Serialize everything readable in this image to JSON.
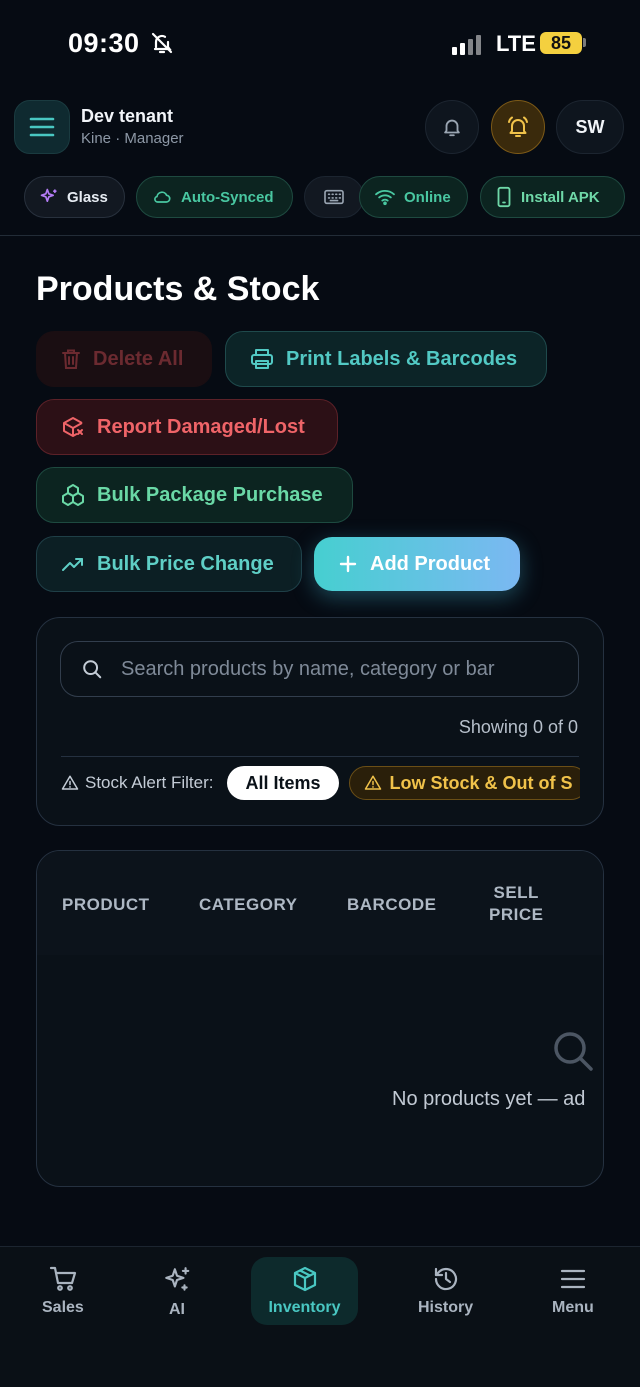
{
  "status_bar": {
    "time": "09:30",
    "network": "LTE",
    "battery": "85"
  },
  "header": {
    "tenant_name": "Dev tenant",
    "tenant_subtitle": "Kine · Manager",
    "avatar_initials": "SW"
  },
  "chips": {
    "glass": "Glass",
    "sync": "Auto-Synced",
    "online": "Online",
    "install": "Install APK"
  },
  "page": {
    "title": "Products & Stock"
  },
  "actions": {
    "delete_all": "Delete All",
    "print_labels": "Print Labels & Barcodes",
    "report_damaged": "Report Damaged/Lost",
    "bulk_package": "Bulk Package Purchase",
    "bulk_price": "Bulk Price Change",
    "add_product": "Add Product"
  },
  "search": {
    "placeholder": "Search products by name, category or bar",
    "showing": "Showing 0 of 0",
    "filter_label": "Stock Alert Filter:",
    "filter_all": "All Items",
    "filter_low": "Low Stock & Out of S"
  },
  "table": {
    "columns": [
      "PRODUCT",
      "CATEGORY",
      "BARCODE",
      "SELL",
      "PRICE"
    ],
    "empty_text": "No products yet — ad"
  },
  "bottom_nav": [
    {
      "label": "Sales",
      "icon": "cart-icon"
    },
    {
      "label": "AI",
      "icon": "sparkles-icon"
    },
    {
      "label": "Inventory",
      "icon": "box-icon",
      "active": true
    },
    {
      "label": "History",
      "icon": "history-icon"
    },
    {
      "label": "Menu",
      "icon": "menu-icon"
    }
  ],
  "colors": {
    "accent": "#49c7c2",
    "danger": "#ef6468",
    "success": "#6ad8a6",
    "warning": "#f0c24a"
  }
}
